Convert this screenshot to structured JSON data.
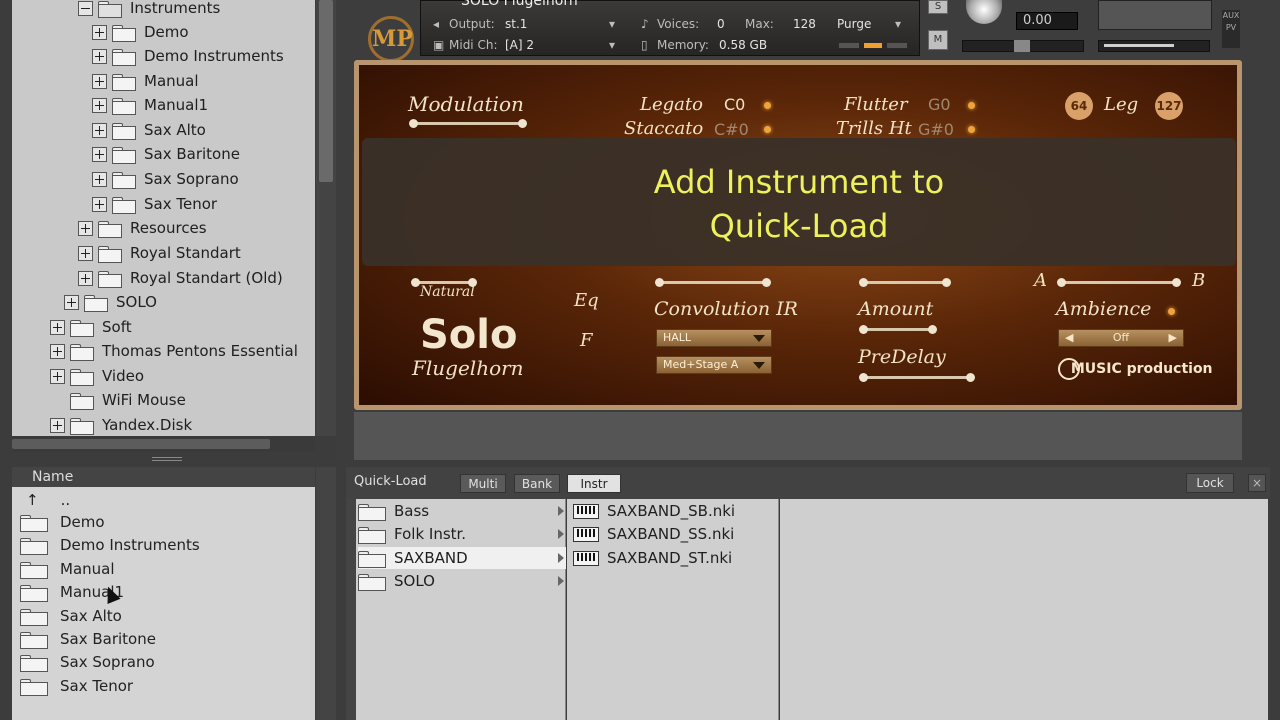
{
  "tree": {
    "items": [
      {
        "label": "Instruments",
        "expanded": true
      },
      {
        "label": "Demo"
      },
      {
        "label": "Demo Instruments"
      },
      {
        "label": "Manual"
      },
      {
        "label": "Manual1"
      },
      {
        "label": "Sax Alto"
      },
      {
        "label": "Sax Baritone"
      },
      {
        "label": "Sax Soprano"
      },
      {
        "label": "Sax Tenor"
      },
      {
        "label": "Resources"
      },
      {
        "label": "Royal Standart"
      },
      {
        "label": "Royal Standart (Old)"
      },
      {
        "label": "SOLO"
      },
      {
        "label": "Soft"
      },
      {
        "label": "Thomas Pentons Essential"
      },
      {
        "label": "Video"
      },
      {
        "label": "WiFi Mouse"
      },
      {
        "label": "Yandex.Disk"
      }
    ]
  },
  "files": {
    "header": "Name",
    "up_label": "..",
    "items": [
      "Demo",
      "Demo Instruments",
      "Manual",
      "Manual1",
      "Sax Alto",
      "Sax Baritone",
      "Sax Soprano",
      "Sax Tenor"
    ]
  },
  "instrument_header": {
    "name": "SOLO Flugelhorn",
    "output_label": "Output:",
    "output_value": "st.1",
    "voices_label": "Voices:",
    "voices_value": "0",
    "max_label": "Max:",
    "max_value": "128",
    "purge_label": "Purge",
    "midi_label": "Midi Ch:",
    "midi_value": "[A]  2",
    "memory_label": "Memory:",
    "memory_value": "0.58 GB",
    "tune_value": "0.00",
    "s_button": "S",
    "m_button": "M",
    "logo": "MP"
  },
  "instrument_panel": {
    "modulation": "Modulation",
    "legato": "Legato",
    "legato_note": "C0",
    "staccato": "Staccato",
    "staccato_note": "C#0",
    "flutter": "Flutter",
    "flutter_note": "G0",
    "trills": "Trills Ht",
    "trills_note": "G#0",
    "badge_low": "64",
    "leg": "Leg",
    "badge_high": "127",
    "natural": "Natural",
    "eq": "Eq",
    "f": "F",
    "convolution": "Convolution IR",
    "hall": "HALL",
    "stage": "Med+Stage A",
    "amount": "Amount",
    "predelay": "PreDelay",
    "mic_a": "A",
    "mic_b": "B",
    "ambience": "Ambience",
    "ambience_value": "Off",
    "solo": "Solo",
    "flugelhorn": "Flugelhorn",
    "music_production": "MUSIC production"
  },
  "overlay": {
    "line1": "Add Instrument to",
    "line2": "Quick-Load"
  },
  "quickload": {
    "title": "Quick-Load",
    "tabs": [
      "Multi",
      "Bank",
      "Instr"
    ],
    "active_tab": "Instr",
    "lock": "Lock",
    "close": "×",
    "folders": [
      "Bass",
      "Folk Instr.",
      "SAXBAND",
      "SOLO"
    ],
    "selected_folder": "SAXBAND",
    "files": [
      "SAXBAND_SB.nki",
      "SAXBAND_SS.nki",
      "SAXBAND_ST.nki"
    ]
  }
}
